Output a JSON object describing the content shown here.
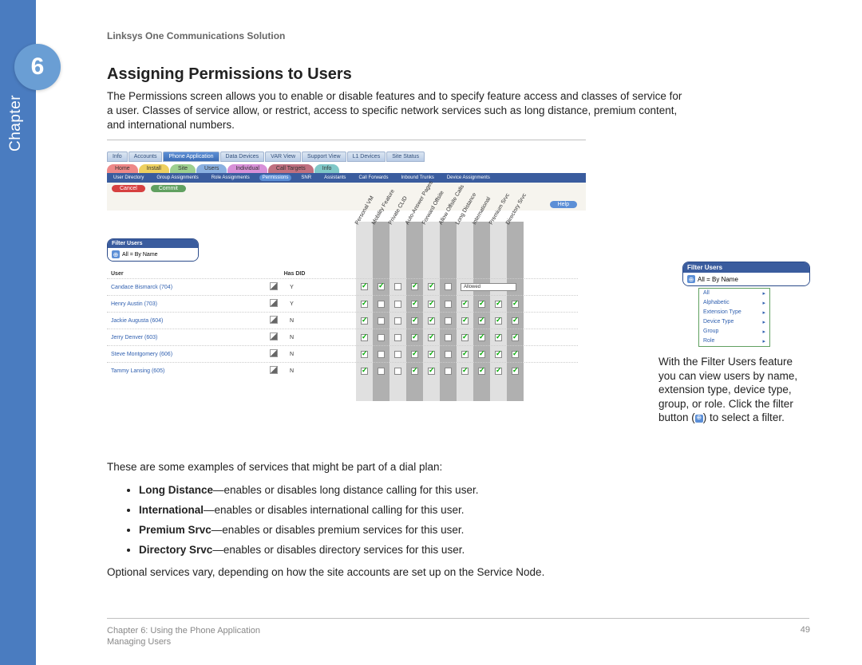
{
  "doc_title": "Linksys One Communications Solution",
  "chapter_num": "6",
  "chapter_label": "Chapter",
  "section_title": "Assigning Permissions to Users",
  "intro": "The Permissions screen allows you to enable or disable features and to specify feature access and classes of service for a user. Classes of service allow, or restrict, access to specific network services such as long distance, premium content, and international numbers.",
  "tabs_top": [
    "Info",
    "Accounts",
    "Phone Application",
    "Data Devices",
    "VAR View",
    "Support View",
    "L1 Devices",
    "Site Status"
  ],
  "tabs_top_active": 2,
  "tabs_mid": [
    "Home",
    "Install",
    "Site",
    "Users",
    "Individual",
    "Call Targets",
    "Info"
  ],
  "nav_sub": [
    "User Directory",
    "Group Assignments",
    "Role Assignments",
    "Permissions",
    "SNR",
    "Assistants",
    "Call Forwards",
    "Inbound Trunks",
    "Device Assignments"
  ],
  "nav_sub_active": 3,
  "btn_cancel": "Cancel",
  "btn_commit": "Commit",
  "btn_help": "Help",
  "filter_header": "Filter Users",
  "filter_value": "All = By Name",
  "perm_columns": [
    "Personal VM",
    "Mobility Feature",
    "Private CLID",
    "Auto-Answer Pages",
    "Forward Offsite",
    "Allow Offsite Calls",
    "Long Distance",
    "International",
    "Premium Srvc",
    "Directory Srvc"
  ],
  "header_user": "User",
  "header_has_did": "Has DID",
  "users": [
    {
      "name": "Candace Bismarck (704)",
      "did": "Y",
      "checks": [
        true,
        true,
        false,
        true,
        true,
        false
      ],
      "allowed": "Allowed"
    },
    {
      "name": "Henry Austin (703)",
      "did": "Y",
      "checks": [
        true,
        false,
        false,
        true,
        true,
        false,
        true,
        true,
        true,
        true
      ]
    },
    {
      "name": "Jackie Augusta (604)",
      "did": "N",
      "checks": [
        true,
        false,
        false,
        true,
        true,
        false,
        true,
        true,
        true,
        true
      ]
    },
    {
      "name": "Jerry Denver (603)",
      "did": "N",
      "checks": [
        true,
        false,
        false,
        true,
        true,
        false,
        true,
        true,
        true,
        true
      ]
    },
    {
      "name": "Steve Montgomery (606)",
      "did": "N",
      "checks": [
        true,
        false,
        false,
        true,
        true,
        false,
        true,
        true,
        true,
        true
      ]
    },
    {
      "name": "Tammy Lansing (605)",
      "did": "N",
      "checks": [
        true,
        false,
        false,
        true,
        true,
        false,
        true,
        true,
        true,
        true
      ]
    }
  ],
  "below_intro": "These are some examples of services that might be part of a dial plan:",
  "bullets": [
    {
      "b": "Long Distance",
      "t": "—enables or disables long distance calling for this user."
    },
    {
      "b": "International",
      "t": "—enables or disables international calling for this user."
    },
    {
      "b": "Premium Srvc",
      "t": "—enables or disables premium services for this user."
    },
    {
      "b": "Directory Srvc",
      "t": "—enables or disables directory services for this user."
    }
  ],
  "optional_text": "Optional services vary, depending on how the site accounts are set up on the Service Node.",
  "callout_menu": [
    "All",
    "Alphabetic",
    "Extension Type",
    "Device Type",
    "Group",
    "Role"
  ],
  "callout_text_1": "With the Filter Users feature you can view users by name, extension type, device type, group, or role. Click the filter button (",
  "callout_text_2": ") to select a filter.",
  "footer_chapter": "Chapter 6: Using the Phone Application",
  "footer_section": "Managing Users",
  "page_num": "49"
}
